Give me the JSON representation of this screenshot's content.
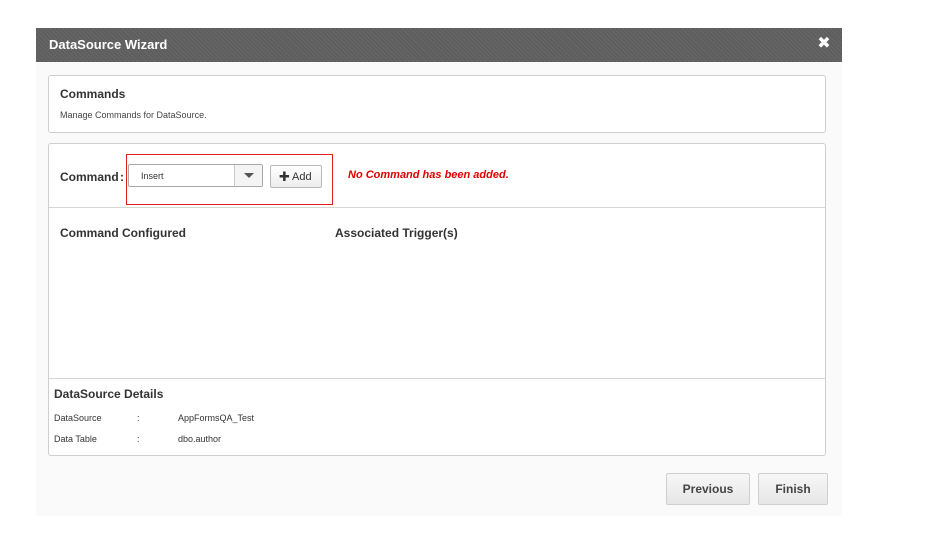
{
  "dialog": {
    "title": "DataSource Wizard",
    "close_glyph": "✖",
    "close_icon": "close-icon"
  },
  "header": {
    "title": "Commands",
    "subtitle": "Manage Commands for DataSource."
  },
  "command": {
    "label": "Command",
    "colon": ":",
    "selected_value": "Insert",
    "add_icon_glyph": "✚",
    "add_label": "Add",
    "empty_message": "No Command has been added.",
    "empty_message_color": "#e00000",
    "highlight_color": "#e02020"
  },
  "columns": {
    "configured": "Command Configured",
    "triggers": "Associated Trigger(s)"
  },
  "details": {
    "title": "DataSource Details",
    "rows": [
      {
        "label": "DataSource",
        "colon": ":",
        "value": "AppFormsQA_Test"
      },
      {
        "label": "Data Table",
        "colon": ":",
        "value": "dbo.author"
      }
    ]
  },
  "footer": {
    "previous_label": "Previous",
    "finish_label": "Finish"
  }
}
